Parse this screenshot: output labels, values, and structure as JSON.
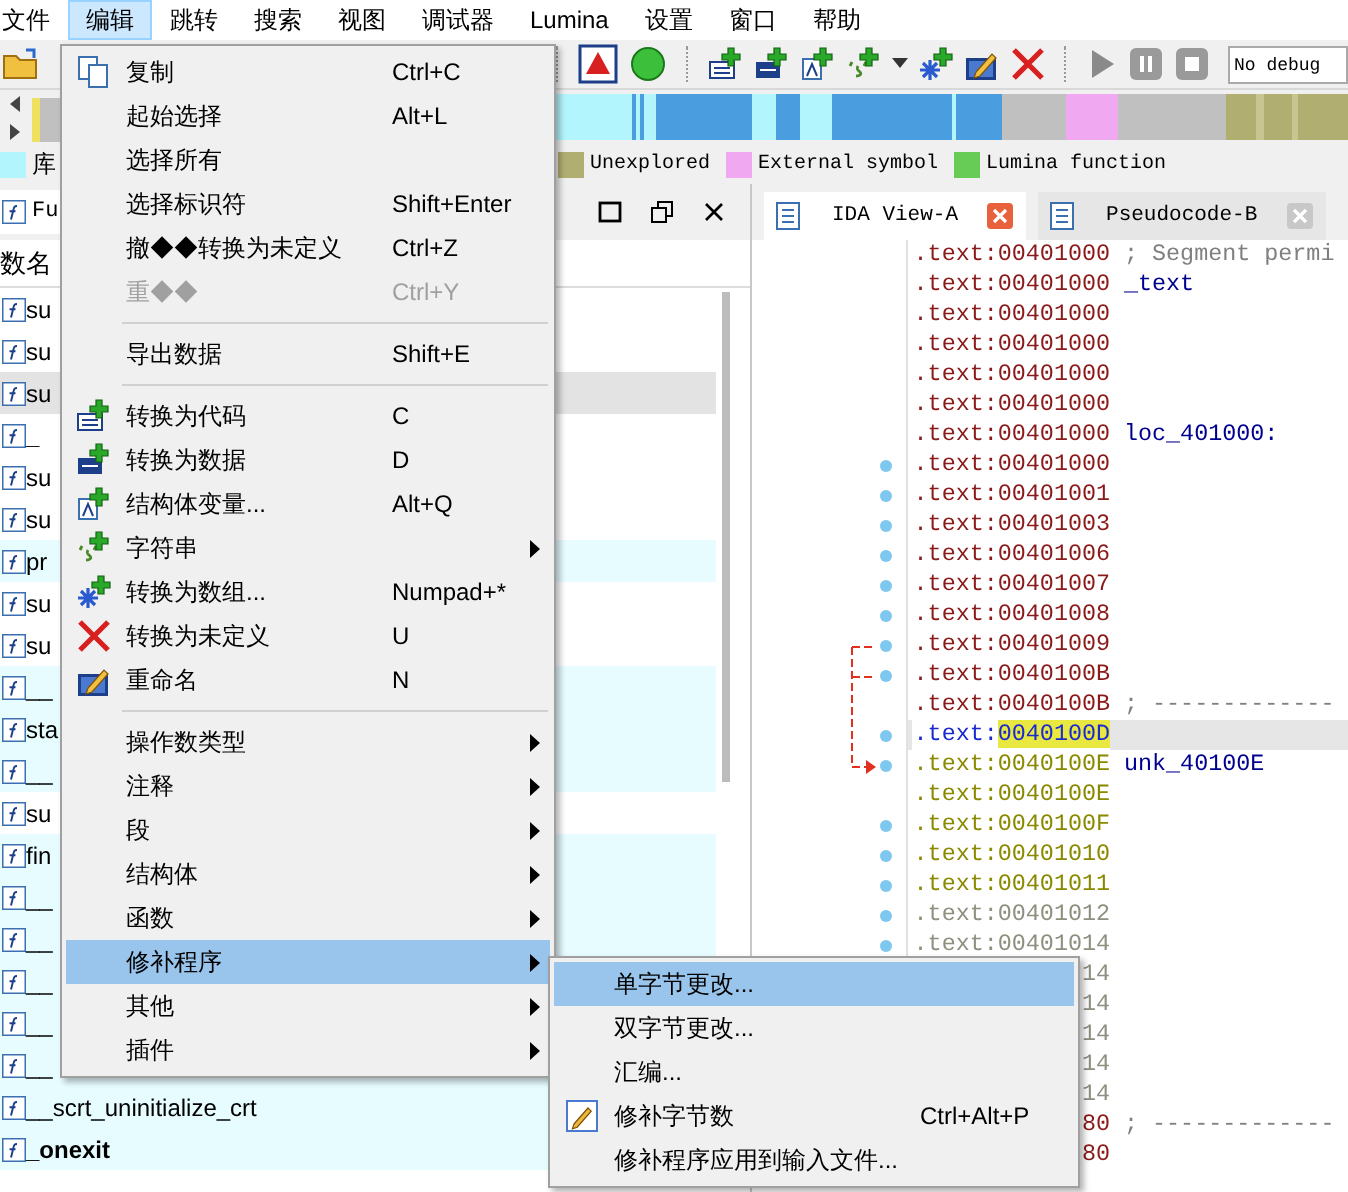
{
  "menubar": [
    {
      "label": "文件",
      "selected": false
    },
    {
      "label": "编辑",
      "selected": true
    },
    {
      "label": "跳转",
      "selected": false
    },
    {
      "label": "搜索",
      "selected": false
    },
    {
      "label": "视图",
      "selected": false
    },
    {
      "label": "调试器",
      "selected": false
    },
    {
      "label": "Lumina",
      "selected": false
    },
    {
      "label": "设置",
      "selected": false
    },
    {
      "label": "窗口",
      "selected": false
    },
    {
      "label": "帮助",
      "selected": false
    }
  ],
  "toolbar": {
    "debugger_field": {
      "value": "No debug"
    }
  },
  "legend": [
    {
      "label": "库",
      "color": "#b3f5fc"
    },
    {
      "label": "Unexplored",
      "color": "#b0ae70"
    },
    {
      "label": "External symbol",
      "color": "#f0a8f0"
    },
    {
      "label": "Lumina function",
      "color": "#66cc55"
    }
  ],
  "functions_panel": {
    "tab": "Fu",
    "column": "数名",
    "rows": [
      {
        "name": "su",
        "kind": "regular",
        "selected": false,
        "bold": false
      },
      {
        "name": "su",
        "kind": "regular",
        "selected": false,
        "bold": false
      },
      {
        "name": "su",
        "kind": "regular",
        "selected": true,
        "bold": false
      },
      {
        "name": "_",
        "kind": "regular",
        "selected": false,
        "bold": true
      },
      {
        "name": "su",
        "kind": "regular",
        "selected": false,
        "bold": false
      },
      {
        "name": "su",
        "kind": "regular",
        "selected": false,
        "bold": false
      },
      {
        "name": "pr",
        "kind": "library",
        "selected": false,
        "bold": false
      },
      {
        "name": "su",
        "kind": "regular",
        "selected": false,
        "bold": false
      },
      {
        "name": "su",
        "kind": "regular",
        "selected": false,
        "bold": false
      },
      {
        "name": "__",
        "kind": "library",
        "selected": false,
        "bold": false
      },
      {
        "name": "sta",
        "kind": "library",
        "selected": false,
        "bold": false
      },
      {
        "name": "__",
        "kind": "library",
        "selected": false,
        "bold": false
      },
      {
        "name": "su",
        "kind": "regular",
        "selected": false,
        "bold": false
      },
      {
        "name": "fin",
        "kind": "library",
        "selected": false,
        "bold": false
      },
      {
        "name": "__",
        "kind": "library",
        "selected": false,
        "bold": false
      },
      {
        "name": "__",
        "kind": "library",
        "selected": false,
        "bold": false
      },
      {
        "name": "__",
        "kind": "library",
        "selected": false,
        "bold": false
      },
      {
        "name": "__",
        "kind": "library",
        "selected": false,
        "bold": false
      },
      {
        "name": "__",
        "kind": "library",
        "selected": false,
        "bold": false
      },
      {
        "name": "__scrt_uninitialize_crt",
        "kind": "library",
        "selected": false,
        "bold": false
      },
      {
        "name": "_onexit",
        "kind": "library",
        "selected": false,
        "bold": true
      }
    ]
  },
  "ida_view": {
    "tabs": [
      {
        "label": "IDA View-A",
        "selected": true
      },
      {
        "label": "Pseudocode-B",
        "selected": false
      }
    ],
    "lines": [
      {
        "segment": ".text:",
        "address": "00401000",
        "kind": "code",
        "dot": false,
        "selected": false,
        "comment": "; Segment permi"
      },
      {
        "segment": ".text:",
        "address": "00401000",
        "kind": "code",
        "dot": false,
        "selected": false,
        "name": "_text"
      },
      {
        "segment": ".text:",
        "address": "00401000",
        "kind": "code",
        "dot": false,
        "selected": false
      },
      {
        "segment": ".text:",
        "address": "00401000",
        "kind": "code",
        "dot": false,
        "selected": false
      },
      {
        "segment": ".text:",
        "address": "00401000",
        "kind": "code",
        "dot": false,
        "selected": false
      },
      {
        "segment": ".text:",
        "address": "00401000",
        "kind": "code",
        "dot": false,
        "selected": false
      },
      {
        "segment": ".text:",
        "address": "00401000",
        "kind": "code",
        "dot": false,
        "selected": false,
        "name": "loc_401000:"
      },
      {
        "segment": ".text:",
        "address": "00401000",
        "kind": "code",
        "dot": true,
        "selected": false
      },
      {
        "segment": ".text:",
        "address": "00401001",
        "kind": "code",
        "dot": true,
        "selected": false
      },
      {
        "segment": ".text:",
        "address": "00401003",
        "kind": "code",
        "dot": true,
        "selected": false
      },
      {
        "segment": ".text:",
        "address": "00401006",
        "kind": "code",
        "dot": true,
        "selected": false
      },
      {
        "segment": ".text:",
        "address": "00401007",
        "kind": "code",
        "dot": true,
        "selected": false
      },
      {
        "segment": ".text:",
        "address": "00401008",
        "kind": "code",
        "dot": true,
        "selected": false
      },
      {
        "segment": ".text:",
        "address": "00401009",
        "kind": "code",
        "dot": true,
        "selected": false
      },
      {
        "segment": ".text:",
        "address": "0040100B",
        "kind": "code",
        "dot": true,
        "selected": false
      },
      {
        "segment": ".text:",
        "address": "0040100B",
        "kind": "code",
        "dot": false,
        "selected": false,
        "comment": "; -------------"
      },
      {
        "segment": ".text:",
        "address": "0040100D",
        "kind": "code",
        "dot": true,
        "selected": true
      },
      {
        "segment": ".text:",
        "address": "0040100E",
        "kind": "data",
        "dot": true,
        "selected": false,
        "name": "unk_40100E"
      },
      {
        "segment": ".text:",
        "address": "0040100E",
        "kind": "data",
        "dot": false,
        "selected": false
      },
      {
        "segment": ".text:",
        "address": "0040100F",
        "kind": "data",
        "dot": true,
        "selected": false
      },
      {
        "segment": ".text:",
        "address": "00401010",
        "kind": "data",
        "dot": true,
        "selected": false
      },
      {
        "segment": ".text:",
        "address": "00401011",
        "kind": "data",
        "dot": true,
        "selected": false
      },
      {
        "segment": ".text:",
        "address": "00401012",
        "kind": "unexplored",
        "dot": true,
        "selected": false
      },
      {
        "segment": ".text:",
        "address": "00401014",
        "kind": "unexplored",
        "dot": true,
        "selected": false
      },
      {
        "address": "14",
        "kind": "unexplored",
        "dot": false,
        "selected": false
      },
      {
        "address": "14",
        "kind": "unexplored",
        "dot": false,
        "selected": false
      },
      {
        "address": "14",
        "kind": "unexplored",
        "dot": false,
        "selected": false
      },
      {
        "address": "14",
        "kind": "unexplored",
        "dot": false,
        "selected": false
      },
      {
        "address": "14",
        "kind": "unexplored",
        "dot": false,
        "selected": false
      },
      {
        "address": "80",
        "kind": "code",
        "dot": false,
        "selected": false,
        "comment": "; -------------"
      },
      {
        "address": "80",
        "kind": "code",
        "dot": false,
        "selected": false
      }
    ]
  },
  "edit_menu": {
    "items": [
      {
        "kind": "copy",
        "label": "复制",
        "shortcut": "Ctrl+C",
        "disabled": false,
        "submenu": false,
        "selected": false
      },
      {
        "kind": "plain",
        "label": "起始选择",
        "shortcut": "Alt+L",
        "disabled": false,
        "submenu": false,
        "selected": false
      },
      {
        "kind": "plain",
        "label": "选择所有",
        "disabled": false,
        "submenu": false,
        "selected": false
      },
      {
        "kind": "plain",
        "label": "选择标识符",
        "shortcut": "Shift+Enter",
        "disabled": false,
        "submenu": false,
        "selected": false
      },
      {
        "kind": "plain",
        "label": "撤◆◆转换为未定义",
        "shortcut": "Ctrl+Z",
        "disabled": false,
        "submenu": false,
        "selected": false
      },
      {
        "kind": "plain",
        "label": "重◆◆",
        "shortcut": "Ctrl+Y",
        "disabled": true,
        "submenu": false,
        "selected": false
      },
      {
        "kind": "separator"
      },
      {
        "kind": "plain",
        "label": "导出数据",
        "shortcut": "Shift+E",
        "disabled": false,
        "submenu": false,
        "selected": false
      },
      {
        "kind": "separator"
      },
      {
        "kind": "make-code",
        "label": "转换为代码",
        "shortcut": "C",
        "disabled": false,
        "submenu": false,
        "selected": false
      },
      {
        "kind": "make-data",
        "label": "转换为数据",
        "shortcut": "D",
        "disabled": false,
        "submenu": false,
        "selected": false
      },
      {
        "kind": "struct-var",
        "label": "结构体变量...",
        "shortcut": "Alt+Q",
        "disabled": false,
        "submenu": false,
        "selected": false
      },
      {
        "kind": "string",
        "label": "字符串",
        "disabled": false,
        "submenu": true,
        "selected": false
      },
      {
        "kind": "array",
        "label": "转换为数组...",
        "shortcut": "Numpad+*",
        "disabled": false,
        "submenu": false,
        "selected": false
      },
      {
        "kind": "undefine",
        "label": "转换为未定义",
        "shortcut": "U",
        "disabled": false,
        "submenu": false,
        "selected": false
      },
      {
        "kind": "rename",
        "label": "重命名",
        "shortcut": "N",
        "disabled": false,
        "submenu": false,
        "selected": false
      },
      {
        "kind": "separator"
      },
      {
        "kind": "plain",
        "label": "操作数类型",
        "disabled": false,
        "submenu": true,
        "selected": false
      },
      {
        "kind": "plain",
        "label": "注释",
        "disabled": false,
        "submenu": true,
        "selected": false
      },
      {
        "kind": "plain",
        "label": "段",
        "disabled": false,
        "submenu": true,
        "selected": false
      },
      {
        "kind": "plain",
        "label": "结构体",
        "disabled": false,
        "submenu": true,
        "selected": false
      },
      {
        "kind": "plain",
        "label": "函数",
        "disabled": false,
        "submenu": true,
        "selected": false
      },
      {
        "kind": "plain",
        "label": "修补程序",
        "disabled": false,
        "submenu": true,
        "selected": true
      },
      {
        "kind": "plain",
        "label": "其他",
        "disabled": false,
        "submenu": true,
        "selected": false
      },
      {
        "kind": "plain",
        "label": "插件",
        "disabled": false,
        "submenu": true,
        "selected": false
      }
    ]
  },
  "patch_submenu": {
    "items": [
      {
        "kind": "plain",
        "label": "单字节更改...",
        "disabled": false,
        "submenu": false,
        "selected": true
      },
      {
        "kind": "plain",
        "label": "双字节更改...",
        "disabled": false,
        "submenu": false,
        "selected": false
      },
      {
        "kind": "plain",
        "label": "汇编...",
        "disabled": false,
        "submenu": false,
        "selected": false
      },
      {
        "kind": "patch",
        "label": "修补字节数",
        "shortcut": "Ctrl+Alt+P",
        "disabled": false,
        "submenu": false,
        "selected": false
      },
      {
        "kind": "plain",
        "label": "修补程序应用到输入文件...",
        "disabled": false,
        "submenu": false,
        "selected": false
      }
    ]
  }
}
